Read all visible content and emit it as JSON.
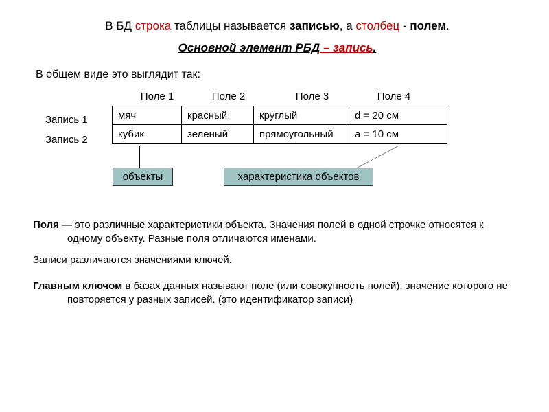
{
  "line1": {
    "t1": "В БД ",
    "t2": "строка",
    "t3": " таблицы называется ",
    "t4": "записью",
    "t5": ", а ",
    "t6": "столбец",
    "t7": " - ",
    "t8": "полем",
    "t9": "."
  },
  "line2": {
    "t1": "Основной элемент РБД",
    "t2": " – ",
    "t3": "запись",
    "t4": "."
  },
  "line3": "В общем виде это выглядит так:",
  "fields": {
    "f1": "Поле 1",
    "f2": "Поле 2",
    "f3": "Поле 3",
    "f4": "Поле 4"
  },
  "rows": {
    "r1": "Запись 1",
    "r2": "Запись 2"
  },
  "table": {
    "r1c1": "мяч",
    "r1c2": "красный",
    "r1c3": "круглый",
    "r1c4": "d = 20 см",
    "r2c1": "кубик",
    "r2c2": "зеленый",
    "r2c3": "прямоугольный",
    "r2c4": "a = 10 см"
  },
  "boxes": {
    "b1": "объекты",
    "b2": "характеристика объектов"
  },
  "p1": {
    "a": "Поля",
    "b": " — это различные характеристики объекта. Значения полей в одной строчке относятся к одному объекту. Разные поля отличаются именами."
  },
  "p2": "Записи различаются значениями ключей.",
  "p3": {
    "a": "Главным ключом",
    "b": " в базах данных называют поле (или совокупность полей), значение которого не повторяется у разных записей. (",
    "c": "это идентификатор записи",
    "d": ")"
  }
}
